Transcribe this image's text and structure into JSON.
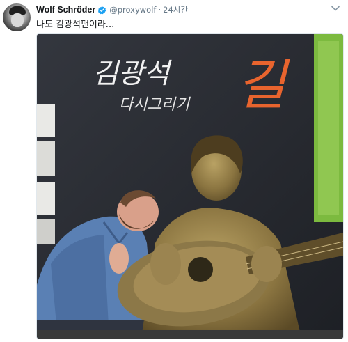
{
  "tweet": {
    "author_name": "Wolf Schröder",
    "handle": "@proxywolf",
    "separator": "·",
    "timestamp": "24시간",
    "text": "나도 김광석팬이라..."
  },
  "photo": {
    "sign_name": "김광석",
    "sign_subtitle": "다시그리기",
    "sign_word": "길"
  },
  "icons": {
    "verified": "verified-badge-icon",
    "caret": "chevron-down-icon"
  },
  "colors": {
    "name_text": "#14171a",
    "secondary_text": "#657786",
    "verified_blue": "#1da1f2",
    "sign_orange": "#e8642e",
    "wall_dark": "#2a2d34"
  }
}
